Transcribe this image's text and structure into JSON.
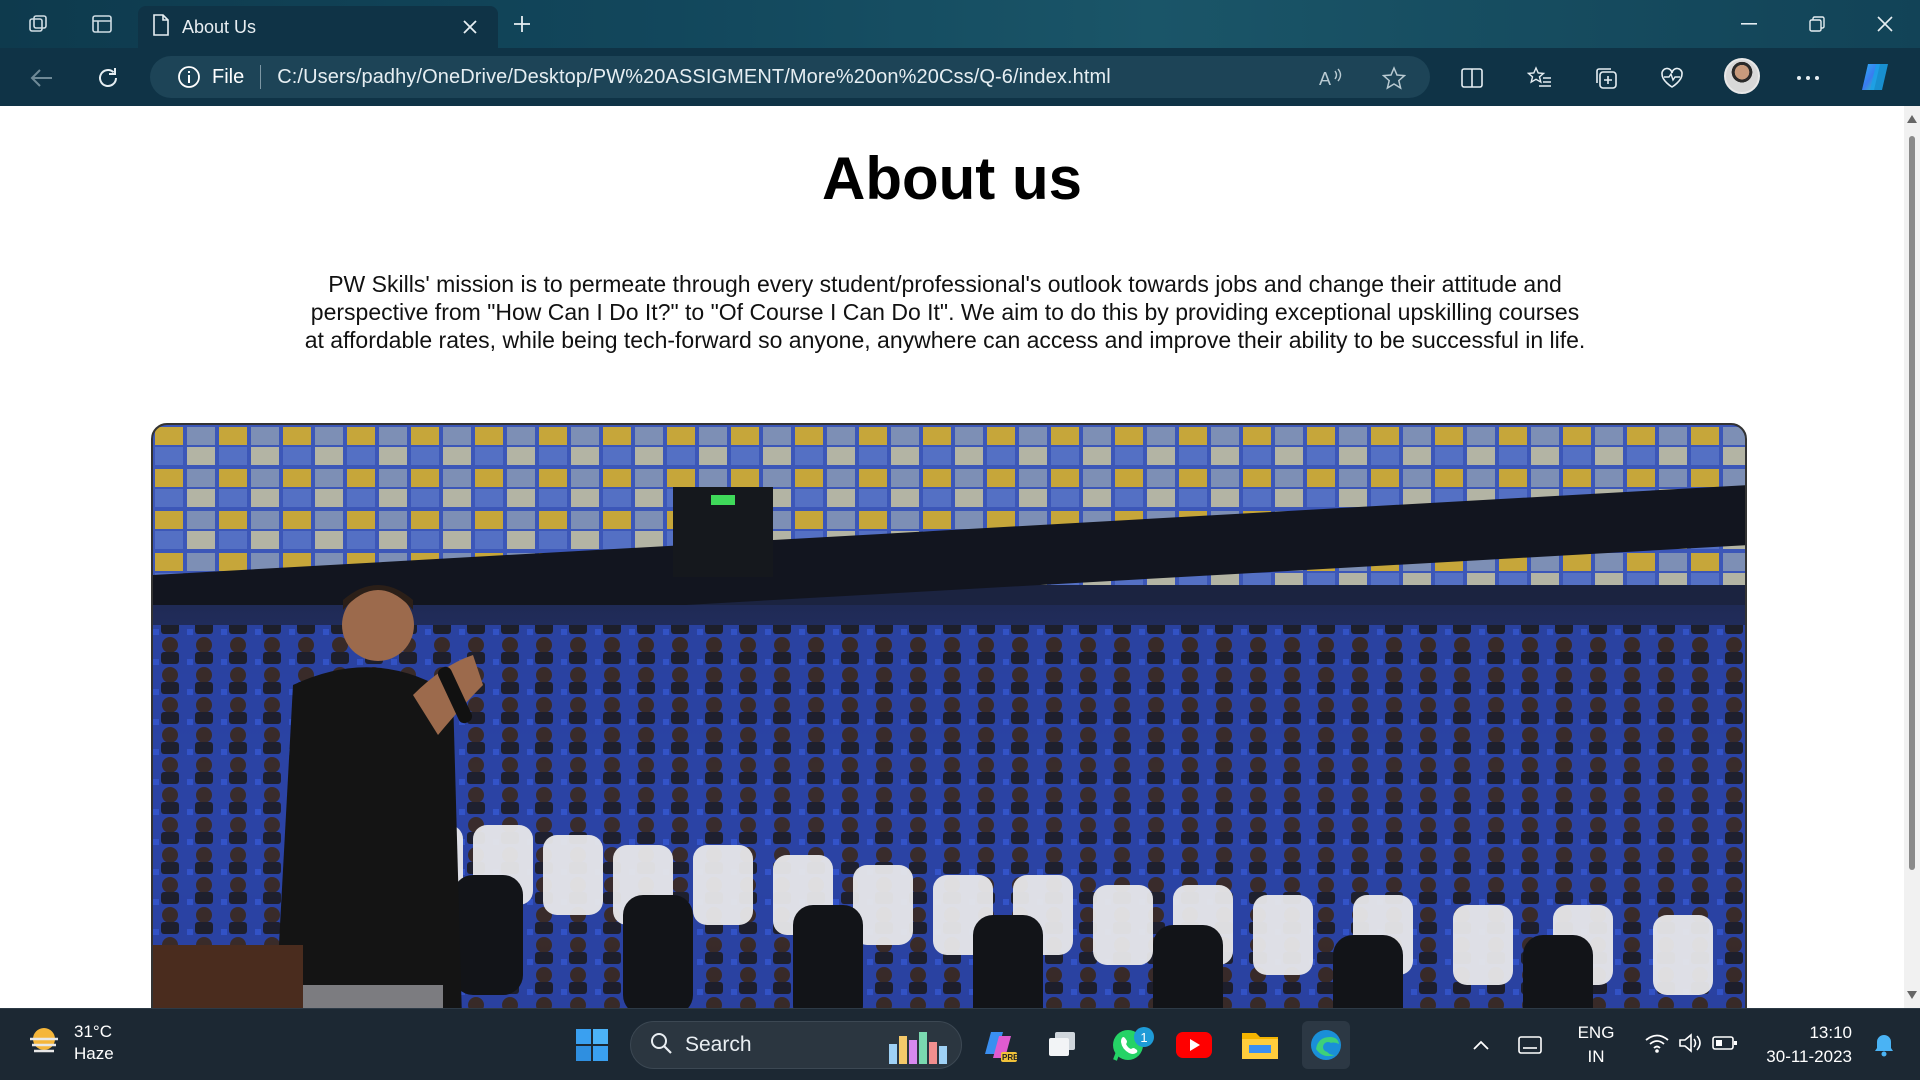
{
  "browser": {
    "tab": {
      "title": "About Us"
    },
    "address": {
      "scheme_label": "File",
      "url": "C:/Users/padhy/OneDrive/Desktop/PW%20ASSIGMENT/More%20on%20Css/Q-6/index.html"
    }
  },
  "page": {
    "heading": "About us",
    "mission": "PW Skills' mission is to permeate through every student/professional's outlook towards jobs and change their attitude and perspective from \"How Can I Do It?\" to \"Of Course I Can Do It\". We aim to do this by providing exceptional upskilling courses at affordable rates, while being tech-forward so anyone, anywhere can access and improve their ability to be successful in life."
  },
  "taskbar": {
    "weather": {
      "temp": "31°C",
      "condition": "Haze"
    },
    "search_label": "Search",
    "whatsapp_badge": "1",
    "language": {
      "lang": "ENG",
      "region": "IN"
    },
    "clock": {
      "time": "13:10",
      "date": "30-11-2023"
    }
  }
}
